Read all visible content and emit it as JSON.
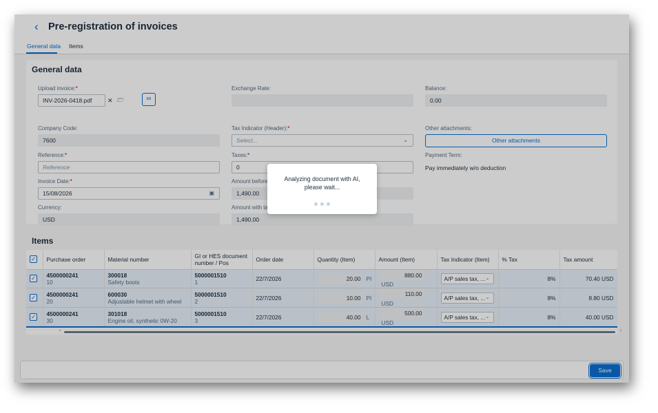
{
  "header": {
    "back_icon": "chevron-left-icon",
    "title": "Pre-registration of invoices",
    "tabs": [
      {
        "label": "General data",
        "selected": true
      },
      {
        "label": "Items",
        "selected": false
      }
    ]
  },
  "general": {
    "section_title": "General data",
    "upload": {
      "label": "Upload invoice:",
      "value": "INV-2026-0418.pdf",
      "clear_icon": "close-icon",
      "browse_icon": "folder-icon",
      "ai_icon": "ai-analyze-icon"
    },
    "company_code": {
      "label": "Company Code:",
      "value": "7600"
    },
    "reference": {
      "label": "Reference:",
      "placeholder": "Reference"
    },
    "invoice_date": {
      "label": "Invoice Date:",
      "value": "15/08/2026",
      "icon": "calendar-icon"
    },
    "currency": {
      "label": "Currency:",
      "value": "USD"
    },
    "exchange_rate": {
      "label": "Exchange Rate:",
      "value": ""
    },
    "tax_indicator": {
      "label": "Tax Indicator (Header):",
      "placeholder": "Select..."
    },
    "taxes": {
      "label": "Taxes:",
      "value": "0"
    },
    "amount_before": {
      "label": "Amount before",
      "value": "1,490.00"
    },
    "amount_with": {
      "label": "Amount with ta",
      "value": "1,490.00"
    },
    "balance": {
      "label": "Balance:",
      "value": "0.00"
    },
    "other_attachments": {
      "label": "Other attachments:",
      "button": "Other attachments"
    },
    "payment_term": {
      "label": "Payment Term:",
      "value": "Pay immediately w/o deduction"
    },
    "required_mark": "*"
  },
  "items": {
    "section_title": "Items",
    "columns": [
      "Purchase order",
      "Material number",
      "GI or HES document number / Pos",
      "Order date",
      "Quantity (Item)",
      "Amount (Item)",
      "Tax Indicator (Item)",
      "% Tax",
      "Tax amount"
    ],
    "rows": [
      {
        "checked": true,
        "po": "4500000241",
        "po_item": "10",
        "material": "300018",
        "material_desc": "Safety boots",
        "doc": "5000001510",
        "pos": "1",
        "order_date": "22/7/2026",
        "qty": "20.00",
        "qty_unit": "PI",
        "amount": "880.00",
        "amount_cur": "USD",
        "tax_ind": "A/P sales tax, ...",
        "tax_pct": "8%",
        "tax_amount": "70.40 USD"
      },
      {
        "checked": true,
        "po": "4500000241",
        "po_item": "20",
        "material": "600030",
        "material_desc": "Adjustable helmet with wheel",
        "doc": "5000001510",
        "pos": "2",
        "order_date": "22/7/2026",
        "qty": "10.00",
        "qty_unit": "PI",
        "amount": "110.00",
        "amount_cur": "USD",
        "tax_ind": "A/P sales tax, ...",
        "tax_pct": "8%",
        "tax_amount": "8.80 USD"
      },
      {
        "checked": true,
        "po": "4500000241",
        "po_item": "30",
        "material": "301018",
        "material_desc": "Engine oil, synthetic 0W-20",
        "doc": "5000001510",
        "pos": "3",
        "order_date": "22/7/2026",
        "qty": "40.00",
        "qty_unit": "L",
        "amount": "500.00",
        "amount_cur": "USD",
        "tax_ind": "A/P sales tax, ...",
        "tax_pct": "8%",
        "tax_amount": "40.00 USD"
      }
    ]
  },
  "footer": {
    "save_label": "Save"
  },
  "busy": {
    "text": "Analyzing document with AI,\nplease wait..."
  },
  "colors": {
    "accent": "#0a6ed1",
    "required": "#bb0000"
  }
}
